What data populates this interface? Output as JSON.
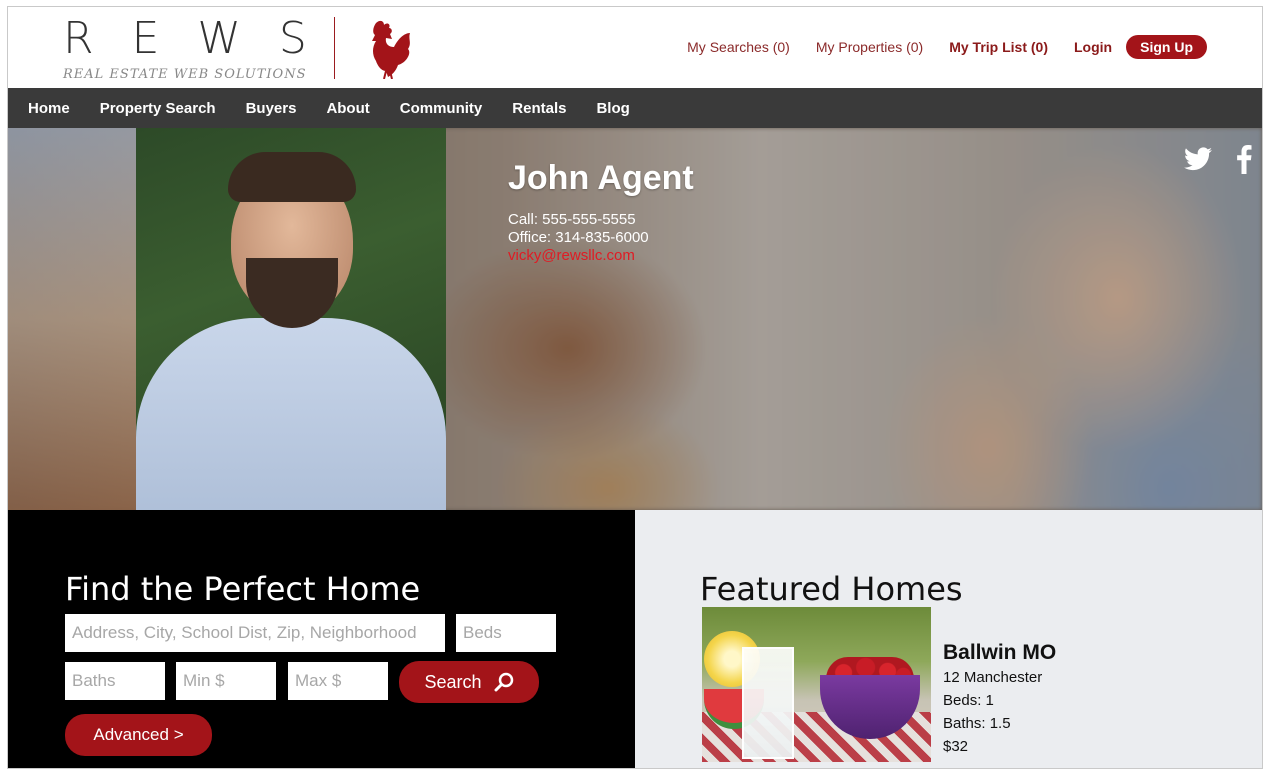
{
  "brand": {
    "logo_letters": "REWS",
    "tagline": "REAL ESTATE WEB SOLUTIONS"
  },
  "top_links": {
    "my_searches": "My Searches (0)",
    "my_properties": "My Properties (0)",
    "my_trip_list": "My Trip List (0)",
    "login": "Login",
    "sign_up": "Sign Up"
  },
  "nav": {
    "items": [
      {
        "label": "Home"
      },
      {
        "label": "Property Search"
      },
      {
        "label": "Buyers"
      },
      {
        "label": "About"
      },
      {
        "label": "Community"
      },
      {
        "label": "Rentals"
      },
      {
        "label": "Blog"
      }
    ]
  },
  "agent": {
    "name": "John Agent",
    "call": "Call: 555-555-5555",
    "office": "Office: 314-835-6000",
    "email": "vicky@rewsllc.com"
  },
  "social": {
    "icons": [
      "twitter-icon",
      "facebook-icon"
    ]
  },
  "search": {
    "title": "Find the Perfect Home",
    "location_placeholder": "Address, City, School Dist, Zip, Neighborhood",
    "beds_placeholder": "Beds",
    "baths_placeholder": "Baths",
    "min_placeholder": "Min $",
    "max_placeholder": "Max $",
    "search_label": "Search",
    "advanced_label": "Advanced >"
  },
  "featured": {
    "title": "Featured Homes",
    "listing": {
      "city": "Ballwin MO",
      "address": "12 Manchester",
      "beds": "Beds: 1",
      "baths": "Baths: 1.5",
      "price": "$32"
    }
  },
  "colors": {
    "accent": "#a31419",
    "nav_bg": "#3a3a3a",
    "search_bg": "#000000",
    "featured_bg": "#ebedf0",
    "email": "#e01b24"
  }
}
